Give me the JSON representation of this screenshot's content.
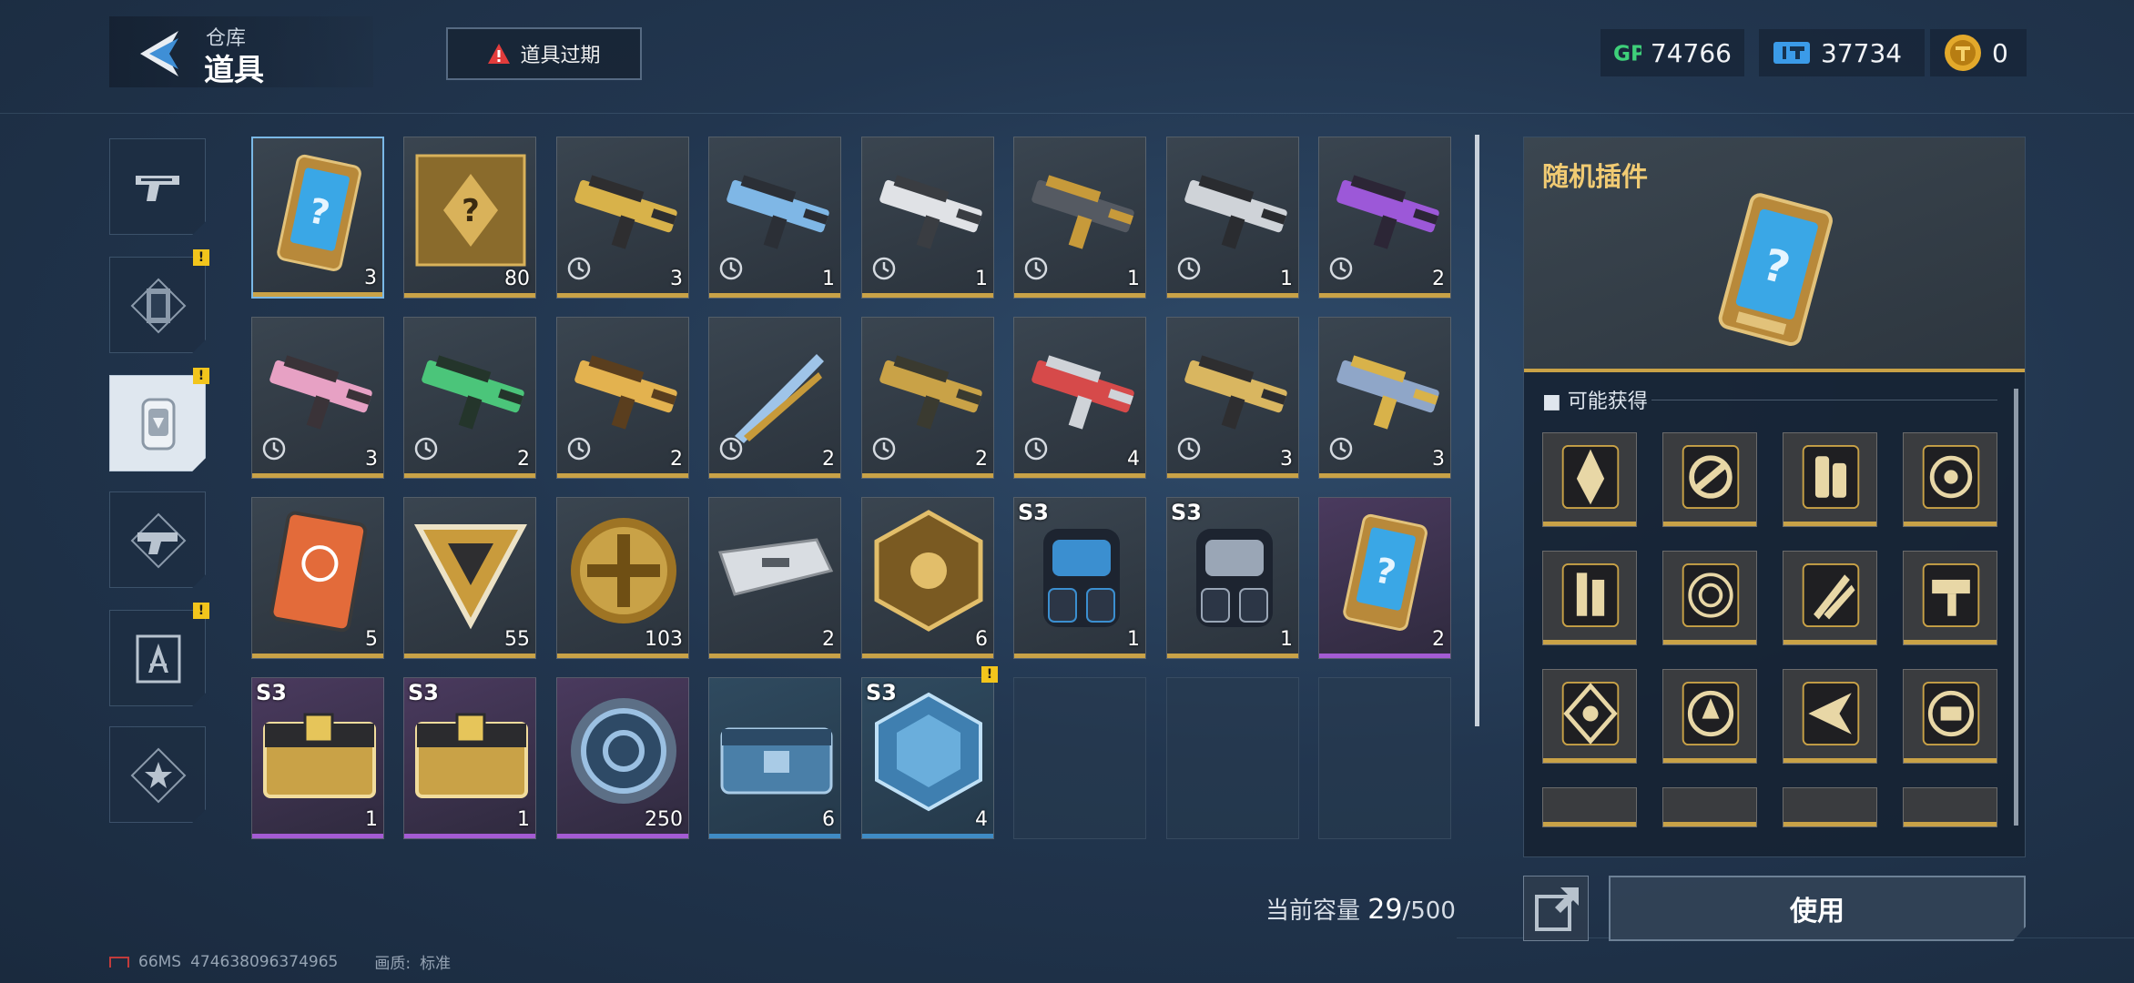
{
  "header": {
    "section": "仓库",
    "title": "道具",
    "expire_button": "道具过期"
  },
  "currencies": [
    {
      "name": "GP",
      "value": "74766",
      "icon": "gp-icon"
    },
    {
      "name": "ticket",
      "value": "37734",
      "icon": "ticket-icon"
    },
    {
      "name": "coin",
      "value": "0",
      "icon": "coin-icon"
    }
  ],
  "nav": [
    {
      "name": "weapons",
      "icon": "pistol-icon",
      "badge": ""
    },
    {
      "name": "cards",
      "icon": "card-icon",
      "badge": "!"
    },
    {
      "name": "items",
      "icon": "item-pack-icon",
      "badge": "!"
    },
    {
      "name": "parts",
      "icon": "parts-icon",
      "badge": ""
    },
    {
      "name": "blueprint",
      "icon": "blueprint-icon",
      "badge": "!"
    },
    {
      "name": "favorites",
      "icon": "star-icon",
      "badge": ""
    }
  ],
  "items": [
    {
      "name": "random-plugin",
      "count": "3",
      "season": "",
      "timer": false,
      "rarity": "gold"
    },
    {
      "name": "blueprint-crate",
      "count": "80",
      "season": "",
      "timer": false,
      "rarity": "gold"
    },
    {
      "name": "gun-gold-smg",
      "count": "3",
      "season": "",
      "timer": true,
      "rarity": "gold"
    },
    {
      "name": "gun-blue-pistol",
      "count": "1",
      "season": "",
      "timer": true,
      "rarity": "gold"
    },
    {
      "name": "gun-white-smg",
      "count": "1",
      "season": "",
      "timer": true,
      "rarity": "gold"
    },
    {
      "name": "gun-dark-smg",
      "count": "1",
      "season": "",
      "timer": true,
      "rarity": "gold"
    },
    {
      "name": "gun-silver-pistol",
      "count": "1",
      "season": "",
      "timer": true,
      "rarity": "gold"
    },
    {
      "name": "gun-purple-rifle",
      "count": "2",
      "season": "",
      "timer": true,
      "rarity": "gold"
    },
    {
      "name": "gun-pink-rifle",
      "count": "3",
      "season": "",
      "timer": true,
      "rarity": "gold"
    },
    {
      "name": "gun-green-rifle",
      "count": "2",
      "season": "",
      "timer": true,
      "rarity": "gold"
    },
    {
      "name": "gun-gold-shotgun",
      "count": "2",
      "season": "",
      "timer": true,
      "rarity": "gold"
    },
    {
      "name": "knife-blue",
      "count": "2",
      "season": "",
      "timer": true,
      "rarity": "gold"
    },
    {
      "name": "gun-gold-pistol",
      "count": "2",
      "season": "",
      "timer": true,
      "rarity": "gold"
    },
    {
      "name": "gun-red-launcher",
      "count": "4",
      "season": "",
      "timer": true,
      "rarity": "gold"
    },
    {
      "name": "gun-gold-sniper",
      "count": "3",
      "season": "",
      "timer": true,
      "rarity": "gold"
    },
    {
      "name": "gun-camo-rifle",
      "count": "3",
      "season": "",
      "timer": true,
      "rarity": "gold"
    },
    {
      "name": "orange-card",
      "count": "5",
      "season": "",
      "timer": false,
      "rarity": "gold"
    },
    {
      "name": "gold-triangle",
      "count": "55",
      "season": "",
      "timer": false,
      "rarity": "gold"
    },
    {
      "name": "gold-coin",
      "count": "103",
      "season": "",
      "timer": false,
      "rarity": "gold"
    },
    {
      "name": "silver-case",
      "count": "2",
      "season": "",
      "timer": false,
      "rarity": "gold"
    },
    {
      "name": "gold-hex-badge",
      "count": "6",
      "season": "",
      "timer": false,
      "rarity": "gold"
    },
    {
      "name": "backpack-blue",
      "count": "1",
      "season": "S3",
      "timer": false,
      "rarity": "gold"
    },
    {
      "name": "backpack-silver",
      "count": "1",
      "season": "S3",
      "timer": false,
      "rarity": "gold"
    },
    {
      "name": "random-plugin-purple",
      "count": "2",
      "season": "",
      "timer": false,
      "rarity": "purple"
    },
    {
      "name": "chest-gold",
      "count": "1",
      "season": "S3",
      "timer": false,
      "rarity": "purple"
    },
    {
      "name": "chest-gold-2",
      "count": "1",
      "season": "S3",
      "timer": false,
      "rarity": "purple"
    },
    {
      "name": "blue-ring-token",
      "count": "250",
      "season": "",
      "timer": false,
      "rarity": "purple"
    },
    {
      "name": "blue-supply-box",
      "count": "6",
      "season": "",
      "timer": false,
      "rarity": "blue"
    },
    {
      "name": "crystal-cube",
      "count": "4",
      "season": "S3",
      "timer": false,
      "rarity": "blue",
      "badge": "!"
    }
  ],
  "capacity": {
    "label": "当前容量",
    "used": "29",
    "separator": "/",
    "max": "500"
  },
  "detail": {
    "name": "随机插件",
    "obtain_label": "可能获得",
    "rewards": [
      "plugin-1",
      "plugin-2",
      "plugin-3",
      "plugin-4",
      "plugin-5",
      "plugin-6",
      "plugin-7",
      "plugin-8",
      "plugin-9",
      "plugin-10",
      "plugin-11",
      "plugin-12"
    ]
  },
  "actions": {
    "use_label": "使用"
  },
  "footer": {
    "ping": "66MS",
    "uid": "474638096374965",
    "quality_label": "画质:",
    "quality": "标准"
  },
  "colors": {
    "gold": "#c9a247",
    "purple": "#a45bd3",
    "blue": "#3f8bc4",
    "accent_text": "#f1cb73",
    "badge": "#f2c51c"
  }
}
